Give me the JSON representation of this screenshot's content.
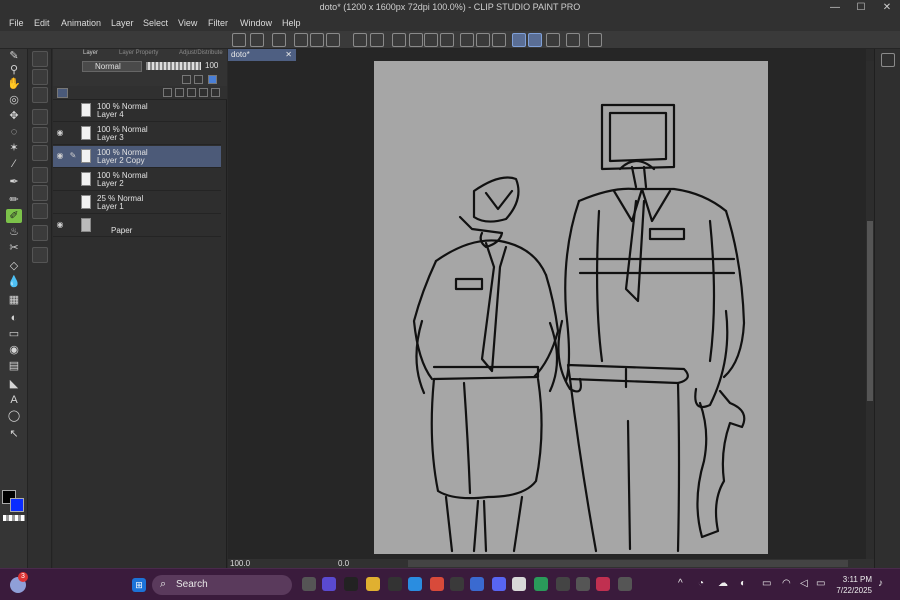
{
  "window": {
    "title": "doto* (1200 x 1600px 72dpi 100.0%)  - CLIP STUDIO PAINT PRO",
    "min": "—",
    "max": "☐",
    "close": "✕"
  },
  "menu": [
    "File",
    "Edit",
    "Animation",
    "Layer",
    "Select",
    "View",
    "Filter",
    "Window",
    "Help"
  ],
  "layer_panel": {
    "tabs": [
      "Layer",
      "Layer Property",
      "Adjust/Distribute"
    ],
    "blend_mode": "Normal",
    "opacity": "100",
    "layers": [
      {
        "opacity": "100 %",
        "mode": "Normal",
        "name": "Layer 4",
        "visible": false,
        "selected": false
      },
      {
        "opacity": "100 %",
        "mode": "Normal",
        "name": "Layer 3",
        "visible": true,
        "selected": false
      },
      {
        "opacity": "100 %",
        "mode": "Normal",
        "name": "Layer 2 Copy",
        "visible": true,
        "selected": true
      },
      {
        "opacity": "100 %",
        "mode": "Normal",
        "name": "Layer 2",
        "visible": false,
        "selected": false
      },
      {
        "opacity": "25 %",
        "mode": "Normal",
        "name": "Layer 1",
        "visible": false,
        "selected": false
      }
    ],
    "paper_label": "Paper"
  },
  "document": {
    "tab_name": "doto*",
    "tab_close": "✕"
  },
  "status": {
    "zoom": "100.0",
    "rotation": "0.0"
  },
  "colors": {
    "foreground": "#000000",
    "background": "#0a2cff",
    "selected_layer": "#4c5a78",
    "active_tool": "#7cc24a",
    "taskbar": "#3a1b3c"
  },
  "taskbar": {
    "search_label": "Search",
    "time": "3:11 PM",
    "date": "7/22/2025",
    "notification_count": "3"
  }
}
